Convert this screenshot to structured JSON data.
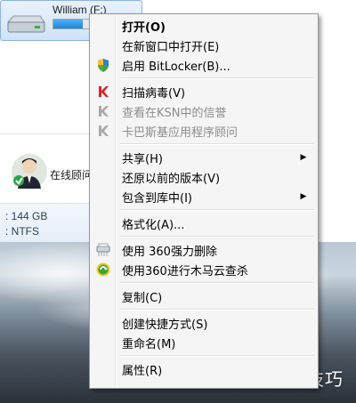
{
  "drive": {
    "label": "William (F:)",
    "used_fraction": 0.35
  },
  "online": {
    "label": "在线顾问"
  },
  "details": {
    "size_text": ": 144 GB",
    "fs_text": ": NTFS"
  },
  "watermark": "软件技巧",
  "context_menu": {
    "open": "打开(O)",
    "open_new_window": "在新窗口中打开(E)",
    "bitlocker": "启用 BitLocker(B)...",
    "scan_virus": "扫描病毒(V)",
    "ksn_reputation": "查看在KSN中的信誉",
    "kaspersky_advisor": "卡巴斯基应用程序顾问",
    "share": "共享(H)",
    "restore_prev": "还原以前的版本(V)",
    "include_library": "包含到库中(I)",
    "format": "格式化(A)...",
    "force_delete_360": "使用 360强力删除",
    "trojan_scan_360": "使用360进行木马云查杀",
    "copy": "复制(C)",
    "create_shortcut": "创建快捷方式(S)",
    "rename": "重命名(M)",
    "properties": "属性(R)"
  }
}
